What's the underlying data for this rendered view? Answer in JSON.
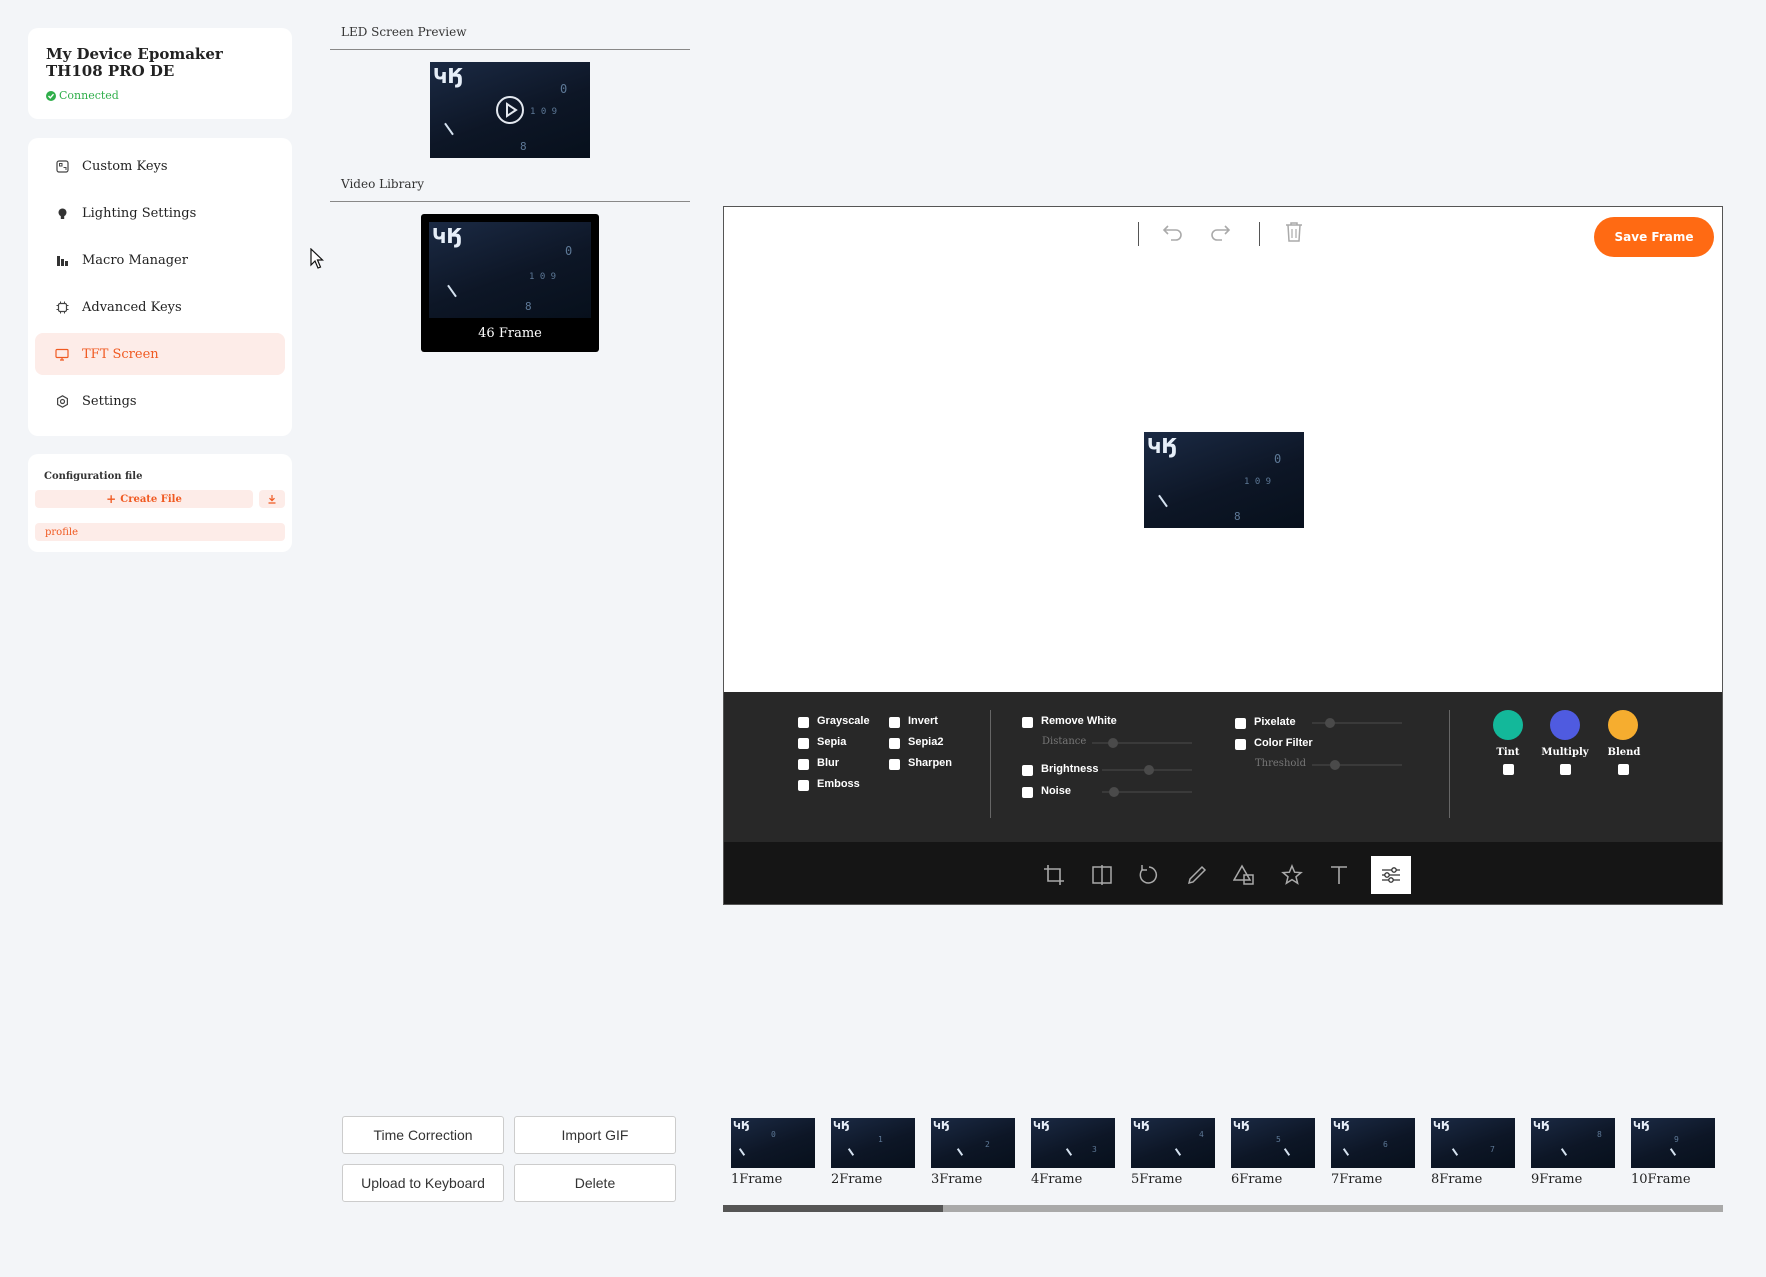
{
  "device": {
    "title": "My Device Epomaker TH108 PRO DE",
    "status": "Connected"
  },
  "nav": {
    "items": [
      {
        "label": "Custom Keys",
        "icon": "keyboard-icon",
        "active": false
      },
      {
        "label": "Lighting Settings",
        "icon": "bulb-icon",
        "active": false
      },
      {
        "label": "Macro Manager",
        "icon": "macro-icon",
        "active": false
      },
      {
        "label": "Advanced Keys",
        "icon": "chip-icon",
        "active": false
      },
      {
        "label": "TFT Screen",
        "icon": "monitor-icon",
        "active": true
      },
      {
        "label": "Settings",
        "icon": "gear-icon",
        "active": false
      }
    ]
  },
  "config": {
    "label": "Configuration file",
    "create_label": "Create File",
    "profile": "profile"
  },
  "preview": {
    "label": "LED Screen Preview"
  },
  "library": {
    "label": "Video Library",
    "item_label": "46 Frame"
  },
  "editor": {
    "save_label": "Save Frame",
    "filters": {
      "col1": [
        "Grayscale",
        "Sepia",
        "Blur",
        "Emboss"
      ],
      "col2": [
        "Invert",
        "Sepia2",
        "Sharpen"
      ],
      "remove_white": "Remove White",
      "distance": "Distance",
      "brightness": "Brightness",
      "noise": "Noise",
      "pixelate": "Pixelate",
      "color_filter": "Color Filter",
      "threshold": "Threshold",
      "tint": "Tint",
      "multiply": "Multiply",
      "blend": "Blend"
    },
    "colors": {
      "tint": "#13b89a",
      "multiply": "#4f5be0",
      "blend": "#f6ad2f",
      "accent": "#ff6a13"
    }
  },
  "actions": {
    "time_correction": "Time Correction",
    "import_gif": "Import GIF",
    "upload": "Upload to Keyboard",
    "delete": "Delete"
  },
  "frames": [
    "1Frame",
    "2Frame",
    "3Frame",
    "4Frame",
    "5Frame",
    "6Frame",
    "7Frame",
    "8Frame",
    "9Frame",
    "10Frame"
  ],
  "scroll_fraction": 0.22
}
